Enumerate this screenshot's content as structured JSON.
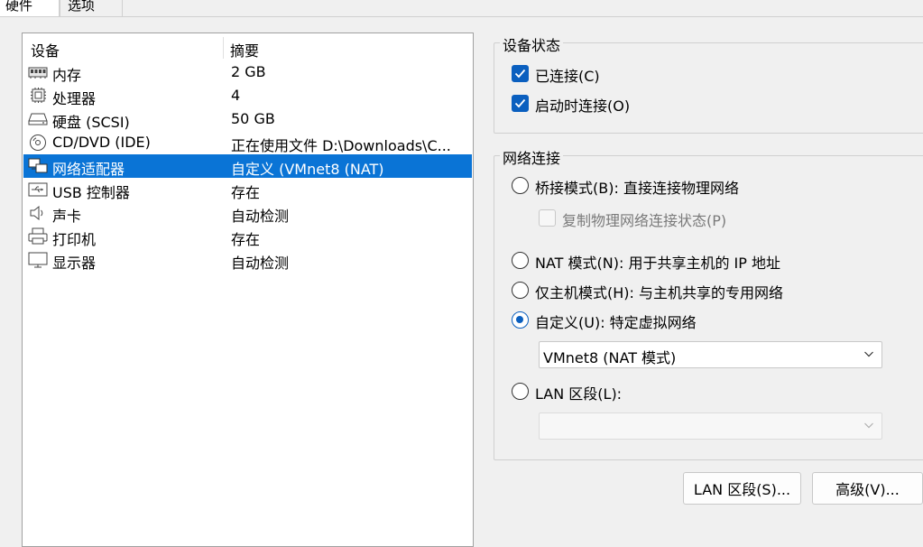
{
  "tabs": [
    {
      "label": "硬件"
    },
    {
      "label": "选项"
    }
  ],
  "device_list": {
    "header_device": "设备",
    "header_summary": "摘要",
    "rows": [
      {
        "name": "内存",
        "summary": "2 GB",
        "icon": "memory-icon"
      },
      {
        "name": "处理器",
        "summary": "4",
        "icon": "processor-icon"
      },
      {
        "name": "硬盘 (SCSI)",
        "summary": "50 GB",
        "icon": "hard-disk-icon"
      },
      {
        "name": "CD/DVD (IDE)",
        "summary": "正在使用文件 D:\\Downloads\\C...",
        "icon": "cd-dvd-icon"
      },
      {
        "name": "网络适配器",
        "summary": "自定义 (VMnet8 (NAT)",
        "icon": "network-adapter-icon"
      },
      {
        "name": "USB 控制器",
        "summary": "存在",
        "icon": "usb-icon"
      },
      {
        "name": "声卡",
        "summary": "自动检测",
        "icon": "speaker-icon"
      },
      {
        "name": "打印机",
        "summary": "存在",
        "icon": "printer-icon"
      },
      {
        "name": "显示器",
        "summary": "自动检测",
        "icon": "monitor-icon"
      }
    ],
    "selected_index": 4
  },
  "device_status": {
    "title": "设备状态",
    "connected": {
      "label": "已连接(C)",
      "checked": true
    },
    "connect_at_power_on": {
      "label": "启动时连接(O)",
      "checked": true
    }
  },
  "network_connection": {
    "title": "网络连接",
    "bridged": {
      "label": "桥接模式(B): 直接连接物理网络",
      "selected": false
    },
    "replicate": {
      "label": "复制物理网络连接状态(P)",
      "checked": false,
      "enabled": false
    },
    "nat": {
      "label": "NAT 模式(N): 用于共享主机的 IP 地址",
      "selected": false
    },
    "host_only": {
      "label": "仅主机模式(H): 与主机共享的专用网络",
      "selected": false
    },
    "custom": {
      "label": "自定义(U): 特定虚拟网络",
      "selected": true
    },
    "custom_select_value": "VMnet8 (NAT 模式)",
    "lan_segment": {
      "label": "LAN 区段(L):",
      "selected": false
    },
    "lan_select_value": ""
  },
  "buttons": {
    "lan_segments": "LAN 区段(S)...",
    "advanced": "高级(V)..."
  },
  "colors": {
    "selection": "#0a74d6",
    "accent": "#0a5fbf"
  }
}
